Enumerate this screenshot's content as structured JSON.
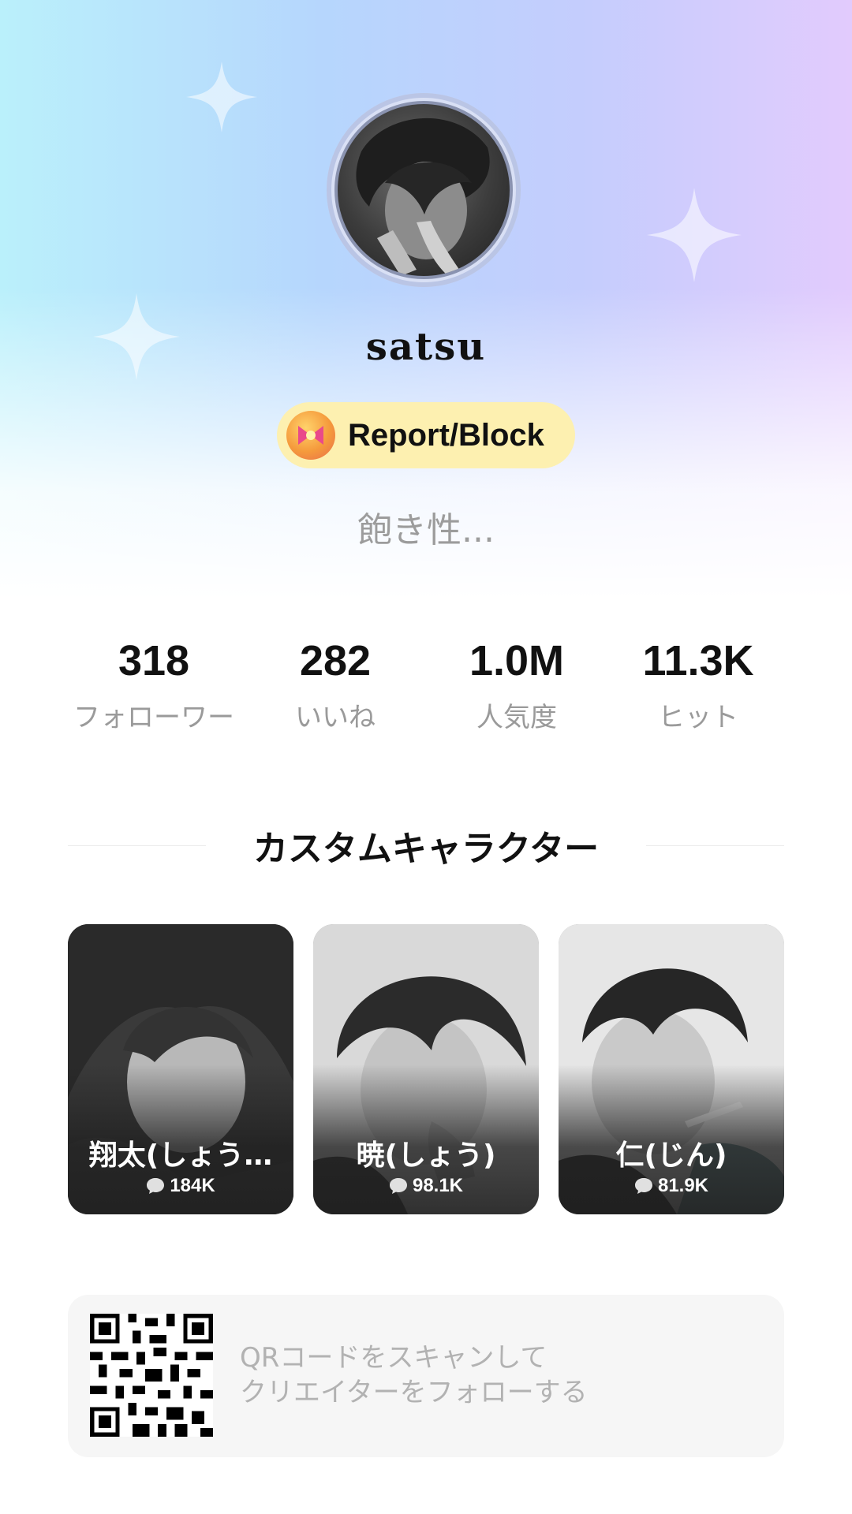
{
  "profile": {
    "username": "satsu",
    "report_label": "Report/Block",
    "bio": "飽き性..."
  },
  "stats": [
    {
      "value": "318",
      "label": "フォローワー"
    },
    {
      "value": "282",
      "label": "いいね"
    },
    {
      "value": "1.0M",
      "label": "人気度"
    },
    {
      "value": "11.3K",
      "label": "ヒット"
    }
  ],
  "section": {
    "title": "カスタムキャラクター"
  },
  "characters": [
    {
      "name": "翔太(しょう…",
      "count": "184K"
    },
    {
      "name": "暁(しょう)",
      "count": "98.1K"
    },
    {
      "name": "仁(じん)",
      "count": "81.9K"
    }
  ],
  "qr": {
    "line1": "QRコードをスキャンして",
    "line2": "クリエイターをフォローする"
  },
  "colors": {
    "report_pill": "#fdf0b0",
    "gradient_left": "#baf0fb",
    "gradient_right": "#e2cbfd"
  }
}
